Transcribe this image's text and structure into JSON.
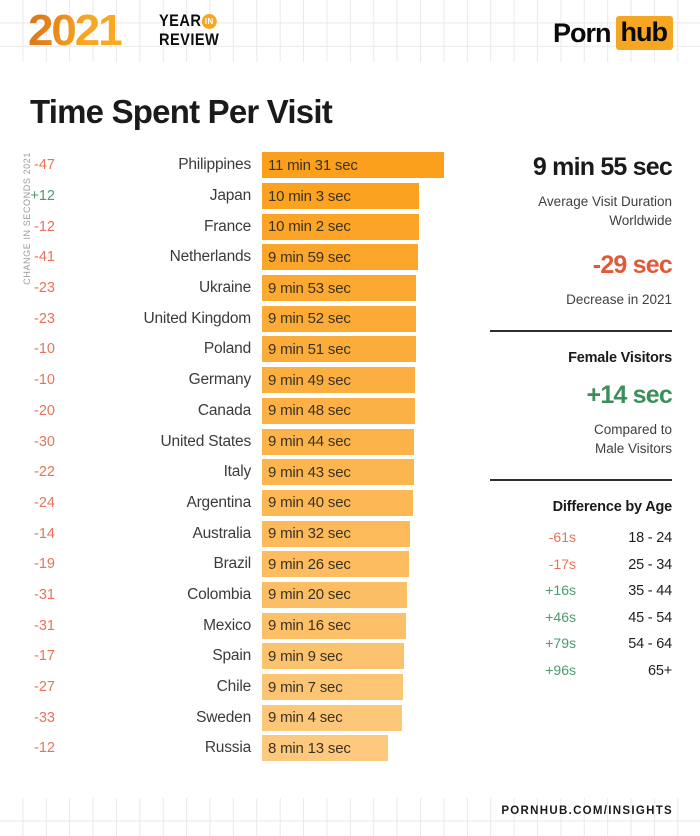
{
  "header": {
    "logo_year": "2021",
    "logo_line1": "YEAR",
    "logo_in": "IN",
    "logo_line2": "REVIEW",
    "brand_part1": "Porn",
    "brand_part2": "hub"
  },
  "page_title": "Time Spent Per Visit",
  "axis_label": "CHANGE IN SECONDS 2021",
  "footer": "PORNHUB.COM/INSIGHTS",
  "colors": {
    "orange": "#F5A623",
    "bar_top": "#FBA01C",
    "bar_bottom": "#FCC97E",
    "negative": "#E8735A",
    "positive": "#4E9A6E",
    "red_stat": "#E05A3A",
    "green_stat": "#3C8F5C",
    "text_dark": "#1A1A1A"
  },
  "panel": {
    "avg_value": "9 min 55 sec",
    "avg_label_line1": "Average Visit Duration",
    "avg_label_line2": "Worldwide",
    "decrease_value": "-29 sec",
    "decrease_label": "Decrease in 2021",
    "female_heading": "Female Visitors",
    "female_value": "+14 sec",
    "female_label_line1": "Compared to",
    "female_label_line2": "Male Visitors",
    "age_heading": "Difference by Age",
    "age_rows": [
      {
        "delta": "-61s",
        "range": "18 - 24",
        "sign": "neg"
      },
      {
        "delta": "-17s",
        "range": "25 - 34",
        "sign": "neg"
      },
      {
        "delta": "+16s",
        "range": "35 - 44",
        "sign": "pos"
      },
      {
        "delta": "+46s",
        "range": "45 - 54",
        "sign": "pos"
      },
      {
        "delta": "+79s",
        "range": "54 - 64",
        "sign": "pos"
      },
      {
        "delta": "+96s",
        "range": "65+",
        "sign": "pos"
      }
    ]
  },
  "chart_data": {
    "type": "bar",
    "title": "Time Spent Per Visit",
    "xlabel": "",
    "ylabel": "CHANGE IN SECONDS 2021",
    "orientation": "horizontal",
    "value_unit": "seconds",
    "categories": [
      "Philippines",
      "Japan",
      "France",
      "Netherlands",
      "Ukraine",
      "United Kingdom",
      "Poland",
      "Germany",
      "Canada",
      "United States",
      "Italy",
      "Argentina",
      "Australia",
      "Brazil",
      "Colombia",
      "Mexico",
      "Spain",
      "Chile",
      "Sweden",
      "Russia"
    ],
    "values": [
      691,
      603,
      602,
      599,
      593,
      592,
      591,
      589,
      588,
      584,
      583,
      580,
      572,
      566,
      560,
      556,
      549,
      547,
      544,
      493
    ],
    "value_labels": [
      "11 min 31 sec",
      "10 min 3 sec",
      "10 min 2 sec",
      "9 min 59 sec",
      "9 min 53 sec",
      "9 min 52 sec",
      "9 min 51 sec",
      "9 min 49 sec",
      "9 min 48 sec",
      "9 min 44 sec",
      "9 min 43 sec",
      "9 min 40 sec",
      "9 min 32 sec",
      "9 min 26 sec",
      "9 min 20 sec",
      "9 min 16 sec",
      "9 min 9 sec",
      "9 min 7 sec",
      "9 min 4 sec",
      "8 min 13 sec"
    ],
    "change_seconds": [
      -47,
      12,
      -12,
      -41,
      -23,
      -23,
      -10,
      -10,
      -20,
      -30,
      -22,
      -24,
      -14,
      -19,
      -31,
      -31,
      -17,
      -27,
      -33,
      -12
    ],
    "change_labels": [
      "-47",
      "+12",
      "-12",
      "-41",
      "-23",
      "-23",
      "-10",
      "-10",
      "-20",
      "-30",
      "-22",
      "-24",
      "-14",
      "-19",
      "-31",
      "-31",
      "-17",
      "-27",
      "-33",
      "-12"
    ],
    "grid": false,
    "legend": false
  }
}
